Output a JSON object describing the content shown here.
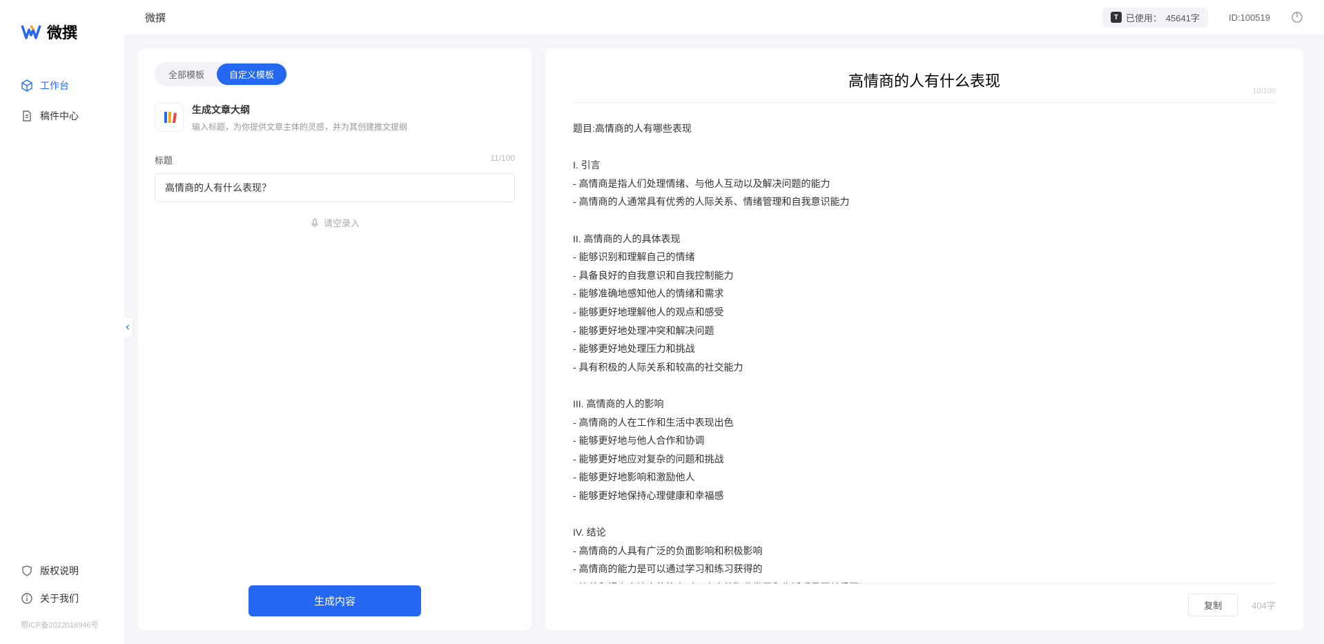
{
  "brand": "微撰",
  "topbar": {
    "title": "微撰",
    "usage_label": "已使用：",
    "usage_value": "45641字",
    "uid_label": "ID:",
    "uid_value": "100519"
  },
  "sidebar": {
    "items": [
      {
        "label": "工作台",
        "icon": "cube",
        "active": true
      },
      {
        "label": "稿件中心",
        "icon": "doc",
        "active": false
      }
    ],
    "bottom": [
      {
        "label": "版权说明",
        "icon": "shield"
      },
      {
        "label": "关于我们",
        "icon": "info"
      }
    ],
    "icp": "鄂ICP备2022016946号"
  },
  "left": {
    "tabs": [
      {
        "label": "全部模板",
        "active": false
      },
      {
        "label": "自定义模板",
        "active": true
      }
    ],
    "template": {
      "name": "生成文章大纲",
      "desc": "输入标题，为你提供文章主体的灵感，并为其创建推文提纲"
    },
    "field": {
      "label": "标题",
      "count": "11/100",
      "value": "高情商的人有什么表现？"
    },
    "voice": "请空录入",
    "generate": "生成内容"
  },
  "right": {
    "title": "高情商的人有什么表现",
    "top_count": "10/100",
    "body": "题目:高情商的人有哪些表现\n\nI. 引言\n- 高情商是指人们处理情绪、与他人互动以及解决问题的能力\n- 高情商的人通常具有优秀的人际关系、情绪管理和自我意识能力\n\nII. 高情商的人的具体表现\n- 能够识别和理解自己的情绪\n- 具备良好的自我意识和自我控制能力\n- 能够准确地感知他人的情绪和需求\n- 能够更好地理解他人的观点和感受\n- 能够更好地处理冲突和解决问题\n- 能够更好地处理压力和挑战\n- 具有积极的人际关系和较高的社交能力\n\nIII. 高情商的人的影响\n- 高情商的人在工作和生活中表现出色\n- 能够更好地与他人合作和协调\n- 能够更好地应对复杂的问题和挑战\n- 能够更好地影响和激励他人\n- 能够更好地保持心理健康和幸福感\n\nIV. 结论\n- 高情商的人具有广泛的负面影响和积极影响\n- 高情商的能力是可以通过学习和练习获得的\n- 培养和提高高情商的能力对于个人的职业发展和生活质量至关重要。",
    "copy": "复制",
    "word_count": "404字"
  }
}
